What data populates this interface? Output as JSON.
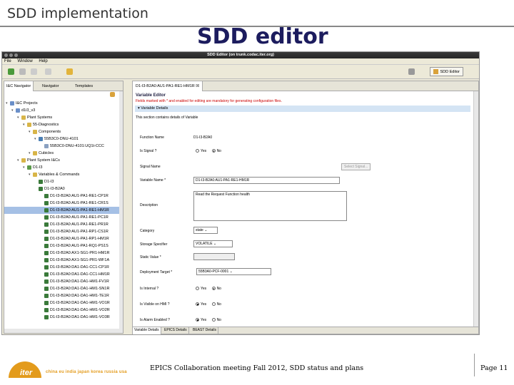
{
  "slide": {
    "title": "SDD implementation",
    "heading": "SDD editor",
    "footer_text": "EPICS Collaboration meeting  Fall 2012, SDD status and plans",
    "page_label": "Page 11",
    "partners": "china eu india japan korea russia usa",
    "logo_text": "iter",
    "accent_color": "#e39b1c"
  },
  "window": {
    "title": "SDD Editor  (on trunk.codac.iter.org)",
    "menu": [
      "File",
      "Window",
      "Help"
    ],
    "perspective_label": "SDD Editor"
  },
  "left_panel": {
    "tabs": [
      "I&C Navigator",
      "Navigator",
      "Templates"
    ],
    "tree": [
      {
        "label": "I&C Projects",
        "level": 0,
        "icon": "project"
      },
      {
        "label": "d1i3_v3",
        "level": 1,
        "icon": "project"
      },
      {
        "label": "Plant Systems",
        "level": 2,
        "icon": "folder"
      },
      {
        "label": "55-Diagnostics",
        "level": 3,
        "icon": "folder"
      },
      {
        "label": "Components",
        "level": 4,
        "icon": "folder"
      },
      {
        "label": "55B3C0-DNU-4101",
        "level": 5,
        "icon": "component"
      },
      {
        "label": "55B3C0-DNU-4101:UQ1t-CCC",
        "level": 6,
        "icon": "leaf"
      },
      {
        "label": "Cubicles",
        "level": 4,
        "icon": "folder"
      },
      {
        "label": "Plant System I&Cs",
        "level": 2,
        "icon": "folder"
      },
      {
        "label": "D1-I3",
        "level": 3,
        "icon": "ics"
      },
      {
        "label": "Variables & Commands",
        "level": 4,
        "icon": "folder"
      },
      {
        "label": "D1-I3",
        "level": 5,
        "icon": "var"
      },
      {
        "label": "D1-I3-B2A0",
        "level": 5,
        "icon": "var"
      },
      {
        "label": "D1-I3-B2A0:AU1-PA1-RE1-CP1R",
        "level": 6,
        "icon": "var"
      },
      {
        "label": "D1-I3-B2A0:AU1-PA1-RE1-CR1S",
        "level": 6,
        "icon": "var"
      },
      {
        "label": "D1-I3-B2A0:AU1-PA1-RE1-HM1R",
        "level": 6,
        "icon": "var",
        "selected": true
      },
      {
        "label": "D1-I3-B2A0:AU1-PA1-RE1-PC1R",
        "level": 6,
        "icon": "var"
      },
      {
        "label": "D1-I3-B2A0:AU1-PA1-RE1-PR1R",
        "level": 6,
        "icon": "var"
      },
      {
        "label": "D1-I3-B2A0:AU1-PA1-RP1-CS1R",
        "level": 6,
        "icon": "var"
      },
      {
        "label": "D1-I3-B2A0:AU1-PA1-RP1-HM1R",
        "level": 6,
        "icon": "var"
      },
      {
        "label": "D1-I3-B2A0:AU1-PA1-RQ1-PS1S",
        "level": 6,
        "icon": "var"
      },
      {
        "label": "D1-I3-B2A0:AX1-SG1-PR1-HM1R",
        "level": 6,
        "icon": "var"
      },
      {
        "label": "D1-I3-B2A0:AX1-SG1-PR1-WF1A",
        "level": 6,
        "icon": "var"
      },
      {
        "label": "D1-I3-B2A0:DA1-DA1-CC1-CP1R",
        "level": 6,
        "icon": "var"
      },
      {
        "label": "D1-I3-B2A0:DA1-DA1-CC1-HM1R",
        "level": 6,
        "icon": "var"
      },
      {
        "label": "D1-I3-B2A0:DA1-DA1-HM1-FV1R",
        "level": 6,
        "icon": "var"
      },
      {
        "label": "D1-I3-B2A0:DA1-DA1-HM1-SN1R",
        "level": 6,
        "icon": "var"
      },
      {
        "label": "D1-I3-B2A0:DA1-DA1-HM1-TE1R",
        "level": 6,
        "icon": "var"
      },
      {
        "label": "D1-I3-B2A0:DA1-DA1-HM1-VO1R",
        "level": 6,
        "icon": "var"
      },
      {
        "label": "D1-I3-B2A0:DA1-DA1-HM1-VO2R",
        "level": 6,
        "icon": "var"
      },
      {
        "label": "D1-I3-B2A0:DA1-DA1-HM1-VO3R",
        "level": 6,
        "icon": "var"
      }
    ]
  },
  "editor": {
    "tab_label": "D1-I3-B2A0:AU1-PA1-RE1-HM1R",
    "title": "Variable Editor",
    "warning": "Fields marked with * and enabled for editing are mandatory for generating configuration files.",
    "section_label": "Variable Details",
    "section_desc": "This section contains details of Variable",
    "fields": {
      "function_name": {
        "label": "Function Name",
        "value": "D1-I3-B2A0"
      },
      "is_signal": {
        "label": "Is Signal ?",
        "yes": "Yes",
        "no": "No",
        "selected": "No"
      },
      "signal_name": {
        "label": "Signal Name",
        "button": "Select Signal..."
      },
      "variable_name": {
        "label": "Variable Name *",
        "value": "D1-I3-B2A0:AU1-PA1-RE1-HM1R"
      },
      "description": {
        "label": "Description",
        "value": "Read the Request Function health"
      },
      "category": {
        "label": "Category",
        "value": "state"
      },
      "storage": {
        "label": "Storage Specifier",
        "value": "VOLATILE"
      },
      "static_value": {
        "label": "Static Value *",
        "value": ""
      },
      "deployment": {
        "label": "Deployment Target *",
        "value": "55B3A0-PCF-0001"
      },
      "is_internal": {
        "label": "Is Internal ?",
        "yes": "Yes",
        "no": "No",
        "selected": "No"
      },
      "is_visible": {
        "label": "Is Visible on HMI ?",
        "yes": "Yes",
        "no": "No",
        "selected": "Yes"
      },
      "is_alarm": {
        "label": "Is Alarm Enabled ?",
        "yes": "Yes",
        "no": "No",
        "selected": "Yes"
      }
    },
    "bottom_tabs": [
      "Variable Details",
      "EPICS Details",
      "BEAST Details"
    ]
  }
}
